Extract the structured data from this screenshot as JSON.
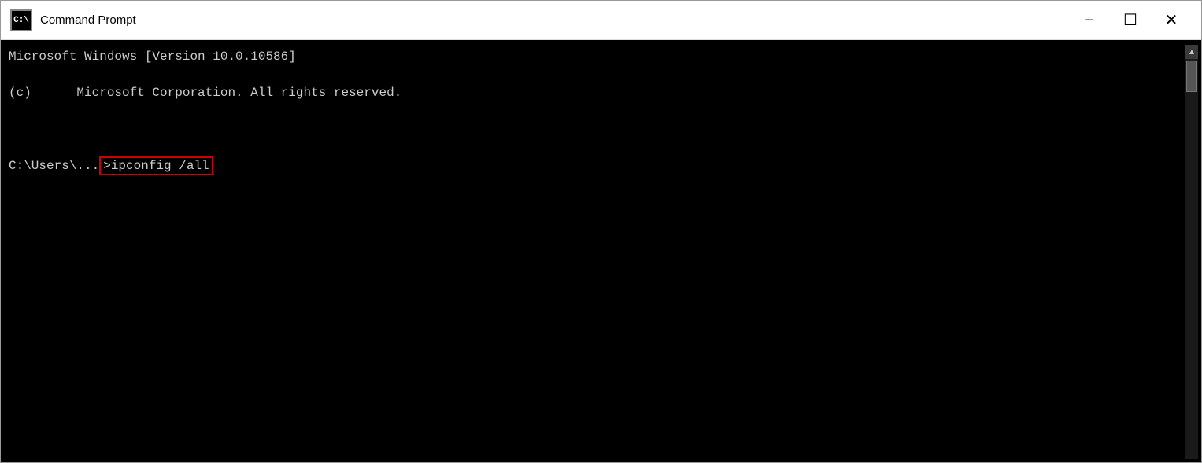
{
  "window": {
    "title": "Command Prompt",
    "icon_label": "C:\\",
    "controls": {
      "minimize": "−",
      "maximize": "☐",
      "close": "✕"
    }
  },
  "terminal": {
    "line1": "Microsoft Windows [Version 10.0.10586]",
    "line2": "(c)      Microsoft Corporation. All rights reserved.",
    "line3": "",
    "prompt": "C:\\Users\\...",
    "command": ">ipconfig /all"
  }
}
